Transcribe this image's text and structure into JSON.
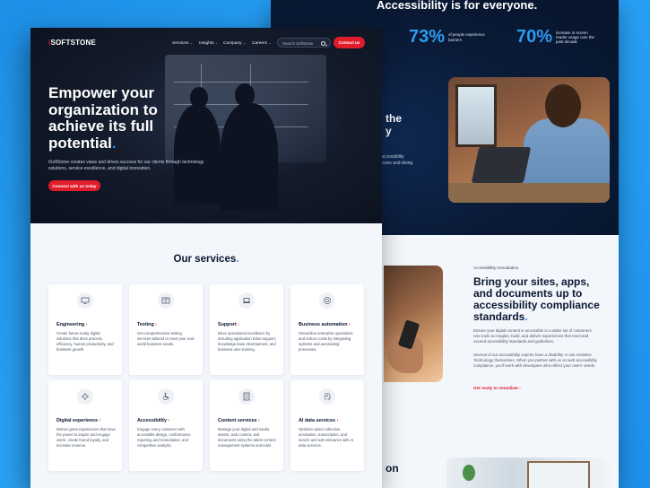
{
  "colors": {
    "accent_blue": "#1e90ea",
    "accent_red": "#e11d2c",
    "dark_navy": "#0b1730",
    "page_bg": "#f3f6fb"
  },
  "back_page": {
    "heading": "Accessibility is for everyone.",
    "stats": [
      {
        "value": "73%",
        "text": "of people experience barriers"
      },
      {
        "value": "70%",
        "text": "increase in screen reader usage over the past decade"
      }
    ],
    "partial_heading": "the\ny",
    "partial_text": "accessibility\nccess and doing",
    "remediation": {
      "label": "Accessibility remediation",
      "heading": "Bring your sites, apps, and documents up to accessibility compliance standards",
      "heading_dot": ".",
      "paragraph_1": "Ensure your digital content is accessible to a wider set of customers. Use tools to imagine, build, and deliver experiences that meet and exceed accessibility standards and guidelines.",
      "paragraph_2": "Several of our accessibility experts have a disability or use Assistive Technology themselves. When you partner with us on web accessibility compliance, you'll work with developers who reflect your users' needs.",
      "link": "Get ready to remediate"
    },
    "bottom_partial_heading": "on"
  },
  "nav": {
    "logo_prefix": "i",
    "logo_text": "SOFTSTONE",
    "items": [
      "Services",
      "Insights",
      "Company",
      "Careers"
    ],
    "search_placeholder": "Search SoftStone",
    "contact_label": "Contact us"
  },
  "hero": {
    "title": "Empower your organization to achieve its full potential",
    "title_dot": ".",
    "description": "iSoftStone creates value and drives success for our clients through technology solutions, service excellence, and digital innovation.",
    "cta_label": "Connect with us today"
  },
  "services": {
    "title": "Our services",
    "title_dot": ".",
    "cards": [
      {
        "icon": "monitor-icon",
        "title": "Engineering",
        "description": "Create future-ready digital solutions that drive process efficiency, human productivity, and business growth."
      },
      {
        "icon": "clipboard-icon",
        "title": "Testing",
        "description": "Get comprehensive testing services tailored to meet your real-world business needs."
      },
      {
        "icon": "laptop-icon",
        "title": "Support",
        "description": "Drive operational excellence by including application ticket support, knowledge base development, and business user training."
      },
      {
        "icon": "gear-cycle-icon",
        "title": "Business automation",
        "description": "Streamline enterprise operations and reduce costs by integrating systems and automating processes."
      },
      {
        "icon": "gear-icon",
        "title": "Digital experience",
        "description": "Deliver great experiences that have the power to inspire and engage users, create brand loyalty, and increase revenue."
      },
      {
        "icon": "wheelchair-icon",
        "title": "Accessibility",
        "description": "Engage every customer with accessible design, conformance reporting and remediation, and competitive analysis."
      },
      {
        "icon": "document-icon",
        "title": "Content services",
        "description": "Manage your digital and media assets, web content, and documents using the latest content management systems and tools."
      },
      {
        "icon": "ai-head-icon",
        "title": "AI data services",
        "description": "Optimize asset collection, annotation, transcription, and search and ads relevance with AI data services."
      }
    ],
    "card_arrow": "›"
  }
}
